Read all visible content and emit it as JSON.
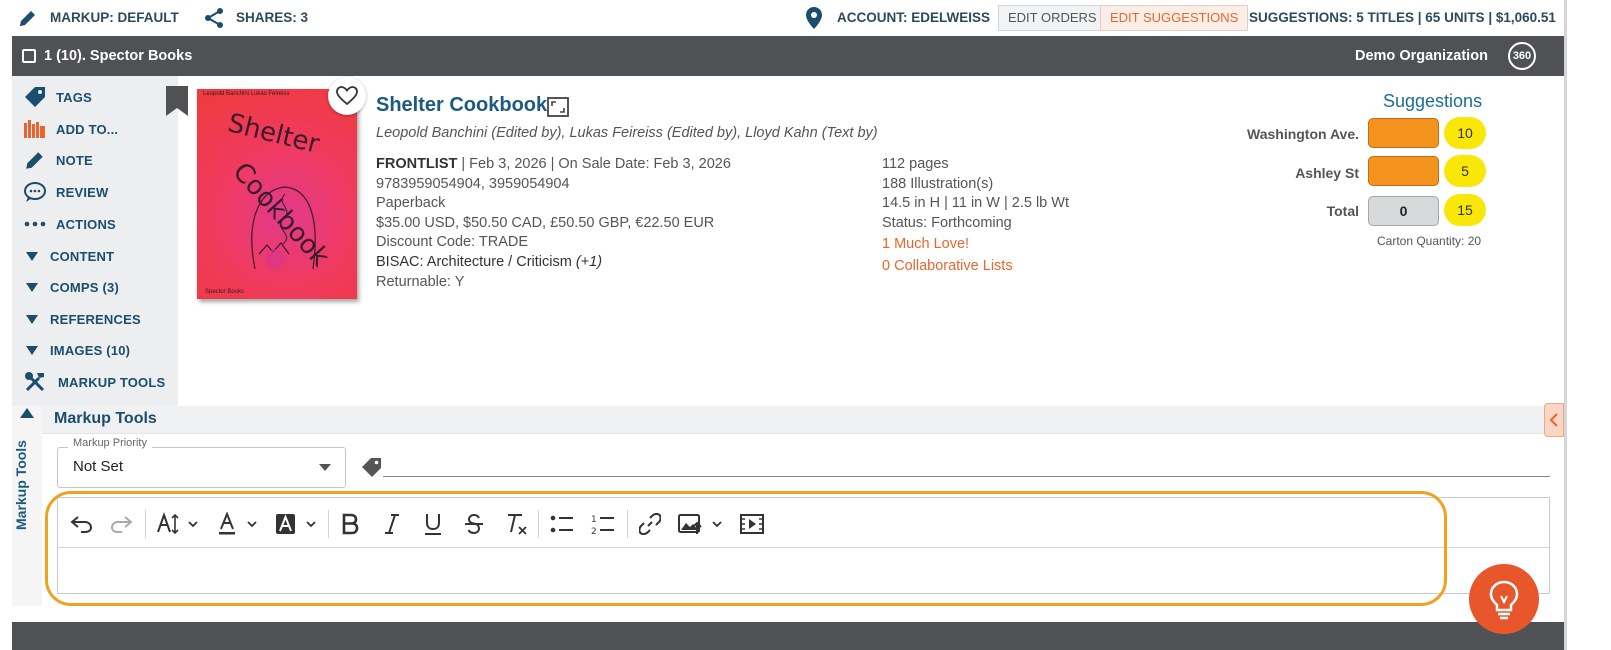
{
  "topbar": {
    "markup": "MARKUP: DEFAULT",
    "shares": "SHARES: 3",
    "account": "ACCOUNT: EDELWEISS",
    "edit_orders": "EDIT ORDERS",
    "edit_suggestions": "EDIT SUGGESTIONS",
    "suggestions_summary": "SUGGESTIONS: 5 TITLES | 65 UNITS | $1,060.51"
  },
  "titlebar": {
    "label": "1 (10). Spector Books",
    "organization": "Demo Organization",
    "badge": "360"
  },
  "sidebar": {
    "items": [
      {
        "label": "TAGS",
        "icon": "tag-icon"
      },
      {
        "label": "ADD TO...",
        "icon": "books-icon"
      },
      {
        "label": "NOTE",
        "icon": "pencil-icon"
      },
      {
        "label": "REVIEW",
        "icon": "speech-bubble-icon"
      },
      {
        "label": "ACTIONS",
        "icon": "more-dots-icon"
      },
      {
        "label": "CONTENT",
        "icon": "triangle-down-icon"
      },
      {
        "label": "COMPS (3)",
        "icon": "triangle-down-icon"
      },
      {
        "label": "REFERENCES",
        "icon": "triangle-down-icon"
      },
      {
        "label": "IMAGES (10)",
        "icon": "triangle-down-icon"
      },
      {
        "label": "MARKUP TOOLS",
        "icon": "tools-icon"
      }
    ]
  },
  "book": {
    "cover_top_text": "Leopold Banchini   Lukas Feireiss",
    "cover_title_line1": "Shelter",
    "cover_title_line2": "Cookbook",
    "cover_publisher": "Spector Books",
    "title": "Shelter Cookbook",
    "authors": "Leopold Banchini (Edited by), Lukas Feireiss (Edited by), Lloyd Kahn (Text by)",
    "frontlist": "FRONTLIST",
    "dates": " | Feb 3, 2026 | On Sale Date: Feb 3, 2026",
    "isbns": "9783959054904, 3959054904",
    "format": "Paperback",
    "prices": "$35.00 USD, $50.50 CAD, £50.50 GBP, €22.50 EUR",
    "discount": "Discount Code: TRADE",
    "bisac": "BISAC: Architecture / Criticism ",
    "bisac_more": "(+1)",
    "returnable": "Returnable: Y",
    "pages": "112 pages",
    "illustrations": "188 Illustration(s)",
    "dimensions": "14.5 in H | 11 in W | 2.5 lb Wt",
    "status": "Status: Forthcoming",
    "love": "1 Much Love!",
    "collab_lists": "0 Collaborative Lists"
  },
  "suggestions": {
    "title": "Suggestions",
    "rows": [
      {
        "store": "Washington Ave.",
        "value": "",
        "count": "10"
      },
      {
        "store": "Ashley St",
        "value": "",
        "count": "5"
      },
      {
        "store": "Total",
        "value": "0",
        "count": "15"
      }
    ],
    "carton": "Carton Quantity: 20"
  },
  "markup_tools": {
    "vertical_label": "Markup Tools",
    "header": "Markup Tools",
    "priority_legend": "Markup Priority",
    "priority_value": "Not Set"
  },
  "colors": {
    "brand_blue": "#1b4d6d",
    "accent_orange": "#e8662e",
    "highlight": "#f0a11f",
    "quantity_orange": "#f4921f",
    "count_yellow": "#f9e70a"
  }
}
